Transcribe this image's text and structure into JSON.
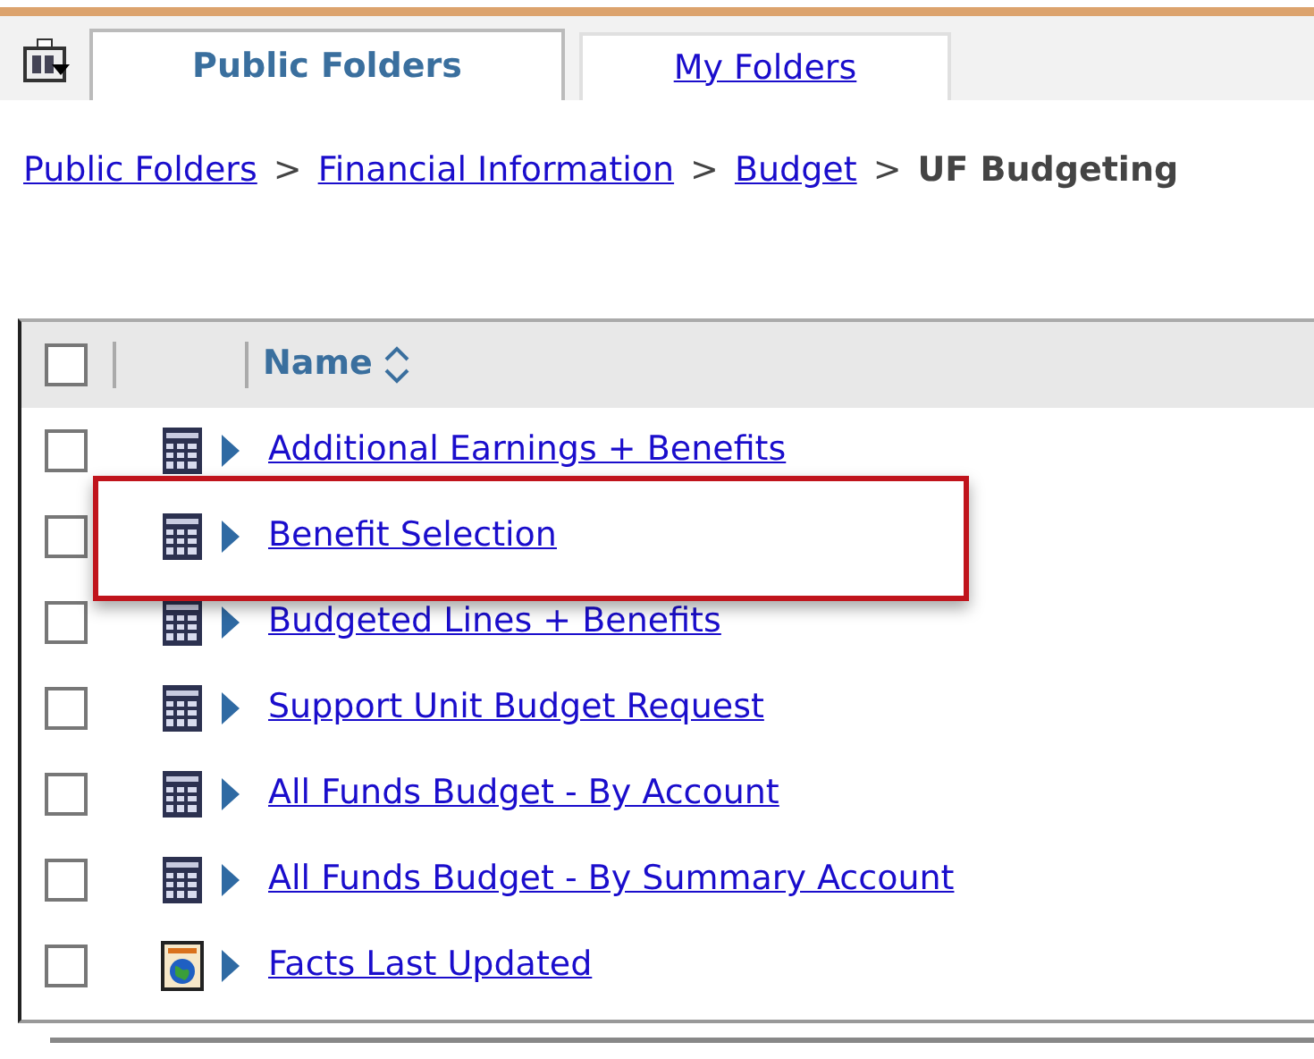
{
  "tabs": [
    {
      "label": "Public Folders",
      "selected": true
    },
    {
      "label": "My Folders",
      "selected": false
    }
  ],
  "breadcrumb": [
    {
      "kind": "link",
      "text": "Public Folders"
    },
    {
      "kind": "separator",
      "text": ">"
    },
    {
      "kind": "link",
      "text": "Financial Information"
    },
    {
      "kind": "separator",
      "text": ">"
    },
    {
      "kind": "link",
      "text": "Budget"
    },
    {
      "kind": "separator",
      "text": ">"
    },
    {
      "kind": "current",
      "text": "UF Budgeting"
    }
  ],
  "table": {
    "select_all": {
      "checked": false
    },
    "columns": [
      {
        "label": "Name",
        "sortable": true
      }
    ],
    "rows": [
      {
        "kind": "report",
        "name": "Additional Earnings + Benefits",
        "checked": false,
        "highlighted": false
      },
      {
        "kind": "report",
        "name": "Benefit Selection",
        "checked": false,
        "highlighted": true
      },
      {
        "kind": "report",
        "name": "Budgeted Lines + Benefits",
        "checked": false,
        "highlighted": false
      },
      {
        "kind": "report",
        "name": "Support Unit Budget Request",
        "checked": false,
        "highlighted": false
      },
      {
        "kind": "report",
        "name": "All Funds Budget - By Account",
        "checked": false,
        "highlighted": false
      },
      {
        "kind": "report",
        "name": "All Funds Budget - By Summary Account",
        "checked": false,
        "highlighted": false
      },
      {
        "kind": "web",
        "name": "Facts Last Updated",
        "checked": false,
        "highlighted": false
      }
    ]
  }
}
